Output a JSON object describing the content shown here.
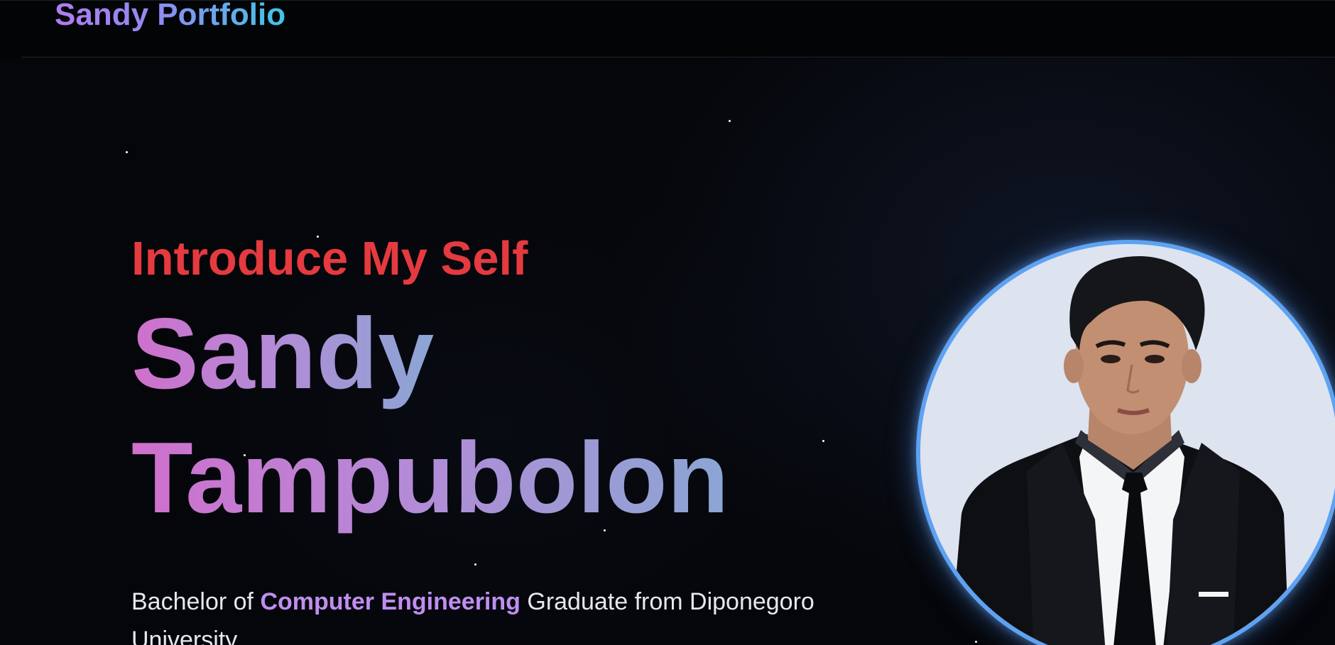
{
  "header": {
    "brand": "Sandy Portfolio"
  },
  "hero": {
    "intro": "Introduce My Self",
    "name_first": "Sandy",
    "name_last": "Tampubolon",
    "tagline_prefix": "Bachelor of ",
    "tagline_highlight": "Computer Engineering",
    "tagline_suffix": " Graduate from Diponegoro University."
  },
  "colors": {
    "background": "#05060a",
    "intro_red": "#e53a3f",
    "accent_purple": "#c08ef0",
    "portrait_ring": "#5ea2f2"
  },
  "portrait": {
    "icon": "profile-photo"
  }
}
